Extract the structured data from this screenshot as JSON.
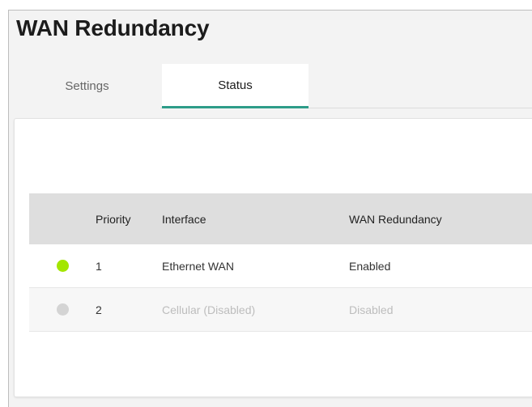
{
  "page": {
    "title": "WAN Redundancy"
  },
  "tabs": [
    {
      "label": "Settings",
      "active": false
    },
    {
      "label": "Status",
      "active": true
    }
  ],
  "colors": {
    "active_tab_underline": "#2d9c89",
    "status_enabled": "#a3e600",
    "status_disabled": "#d4d4d4"
  },
  "table": {
    "headers": {
      "status": "",
      "priority": "Priority",
      "interface": "Interface",
      "wan_redundancy": "WAN Redundancy"
    },
    "rows": [
      {
        "status_icon": "green-dot",
        "priority": "1",
        "interface": "Ethernet WAN",
        "wan_redundancy": "Enabled"
      },
      {
        "status_icon": "grey-dot",
        "priority": "2",
        "interface": "Cellular (Disabled)",
        "wan_redundancy": "Disabled"
      }
    ]
  }
}
